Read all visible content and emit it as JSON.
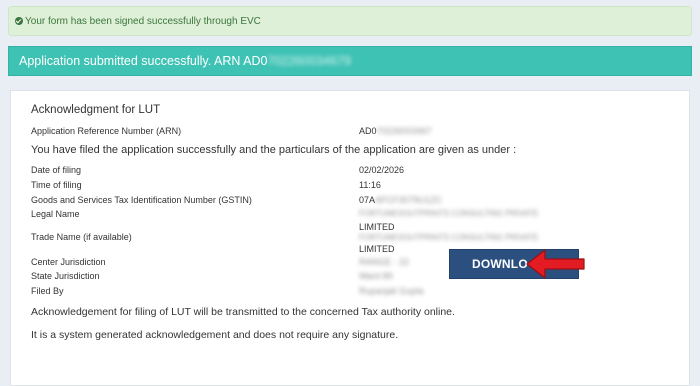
{
  "success_message": "Your form has been signed successfully through EVC",
  "banner": {
    "prefix": "Application submitted successfully. ARN AD0",
    "masked_tail": "702260034679"
  },
  "ack": {
    "title": "Acknowledgment for LUT",
    "arn_label": "Application Reference Number (ARN)",
    "arn_value_prefix": "AD0",
    "arn_value_masked": "70226003467",
    "intro": "You have filed the application successfully and the particulars of the application are given as under :",
    "rows": [
      {
        "label": "Date of filing",
        "value": "02/02/2026"
      },
      {
        "label": "Time of filing",
        "value": "11:16"
      },
      {
        "label": "Goods and Services Tax Identification Number (GSTIN)",
        "value_prefix": "07A",
        "value_masked": "AFCF3079U1ZC"
      },
      {
        "label": "Legal Name",
        "value_masked": "FORTUNESOUTPRINTS CONSULTING PRIVATE",
        "value_tail": "LIMITED"
      },
      {
        "label": "Trade Name (if available)",
        "value_masked": "FORTUNESOUTPRINTS CONSULTING PRIVATE",
        "value_tail": "LIMITED"
      },
      {
        "label": "Center Jurisdiction",
        "value_masked": "RANGE - 22"
      },
      {
        "label": "State Jurisdiction",
        "value_masked": "Ward 89"
      },
      {
        "label": "Filed By",
        "value_masked": "Rupanjali Gupta"
      }
    ],
    "note_1": "Acknowledgement for filing of LUT will be transmitted to the concerned Tax authority online.",
    "note_2": "It is a system generated acknowledgement and does not require any signature."
  },
  "download_label": "DOWNLO",
  "colors": {
    "success_bg": "#dff0d8",
    "banner_bg": "#3ec2b4",
    "button_bg": "#2b4f7e",
    "arrow": "#e31b23"
  }
}
